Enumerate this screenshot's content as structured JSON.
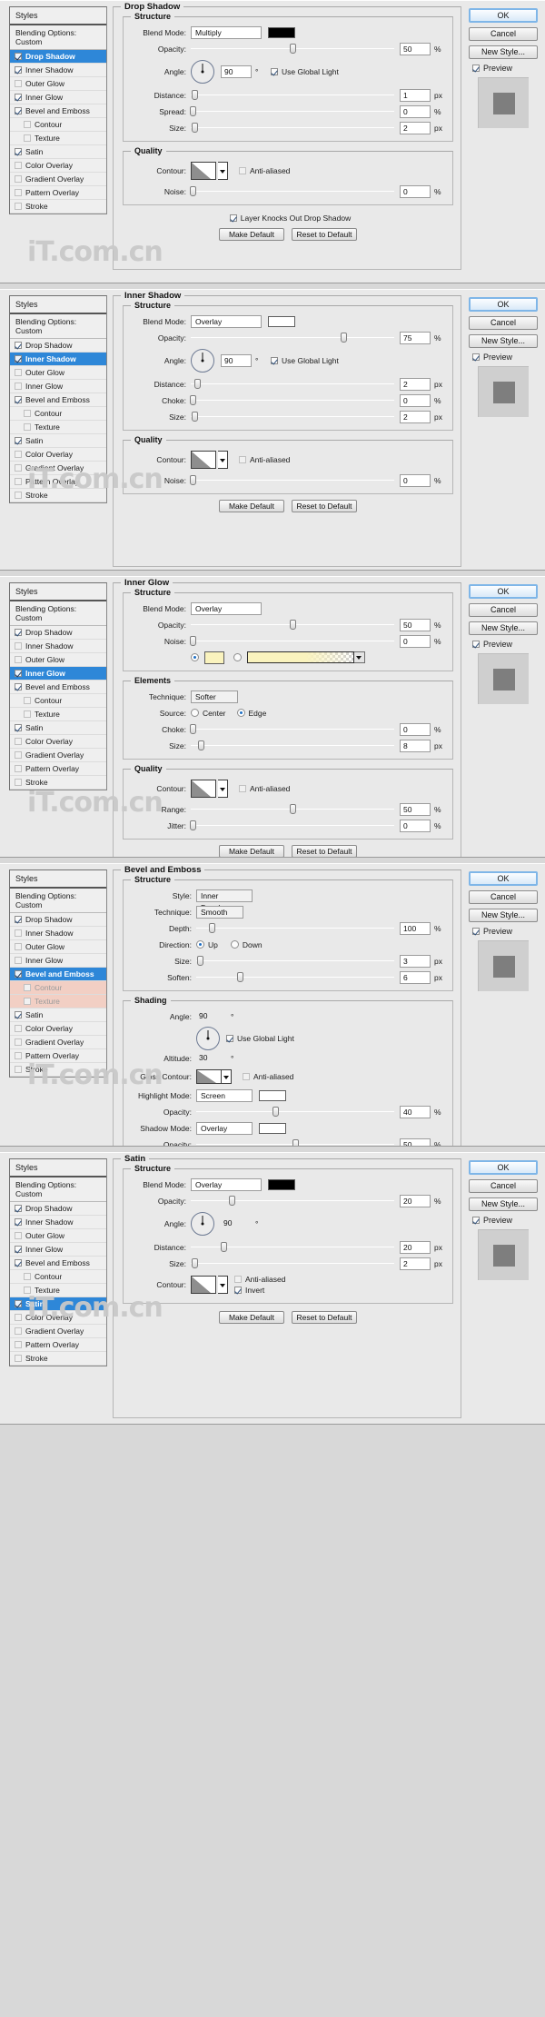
{
  "app": {
    "watermark": "iT.com.cn"
  },
  "buttons": {
    "ok": "OK",
    "cancel": "Cancel",
    "new_style": "New Style...",
    "preview": "Preview",
    "make_default": "Make Default",
    "reset_default": "Reset to Default"
  },
  "styles_panel": {
    "title": "Styles",
    "blending_options": "Blending Options: Custom",
    "items": [
      {
        "label": "Drop Shadow"
      },
      {
        "label": "Inner Shadow"
      },
      {
        "label": "Outer Glow"
      },
      {
        "label": "Inner Glow"
      },
      {
        "label": "Bevel and Emboss"
      },
      {
        "label": "Contour"
      },
      {
        "label": "Texture"
      },
      {
        "label": "Satin"
      },
      {
        "label": "Color Overlay"
      },
      {
        "label": "Gradient Overlay"
      },
      {
        "label": "Pattern Overlay"
      },
      {
        "label": "Stroke"
      }
    ]
  },
  "labels": {
    "structure": "Structure",
    "quality": "Quality",
    "elements": "Elements",
    "shading": "Shading",
    "blend_mode": "Blend Mode:",
    "opacity": "Opacity:",
    "angle": "Angle:",
    "distance": "Distance:",
    "spread": "Spread:",
    "size": "Size:",
    "contour": "Contour:",
    "noise": "Noise:",
    "choke": "Choke:",
    "range": "Range:",
    "jitter": "Jitter:",
    "technique": "Technique:",
    "source": "Source:",
    "style": "Style:",
    "depth": "Depth:",
    "direction": "Direction:",
    "soften": "Soften:",
    "altitude": "Altitude:",
    "gloss_contour": "Gloss Contour:",
    "highlight_mode": "Highlight Mode:",
    "shadow_mode": "Shadow Mode:",
    "anti_aliased": "Anti-aliased",
    "use_global_light": "Use Global Light",
    "layer_knocks_out": "Layer Knocks Out Drop Shadow",
    "invert": "Invert",
    "center": "Center",
    "edge": "Edge",
    "up": "Up",
    "down": "Down",
    "pct": "%",
    "px": "px",
    "deg": "°"
  },
  "dialogs": [
    {
      "title": "Drop Shadow",
      "selected_style": "Drop Shadow",
      "blend_mode": "Multiply",
      "color": "#000000",
      "opacity": "50",
      "angle": "90",
      "use_global_light": true,
      "distance": "1",
      "spread": "0",
      "size": "2",
      "noise": "0",
      "anti_aliased": false,
      "layer_knocks_out": true
    },
    {
      "title": "Inner Shadow",
      "selected_style": "Inner Shadow",
      "blend_mode": "Overlay",
      "color": "#ffffff",
      "opacity": "75",
      "angle": "90",
      "use_global_light": true,
      "distance": "2",
      "choke": "0",
      "size": "2",
      "noise": "0",
      "anti_aliased": false
    },
    {
      "title": "Inner Glow",
      "selected_style": "Inner Glow",
      "blend_mode": "Overlay",
      "opacity": "50",
      "noise": "0",
      "fill_type": "color",
      "color": "#faf3be",
      "technique": "Softer",
      "source": "Edge",
      "choke": "0",
      "size": "8",
      "anti_aliased": false,
      "range": "50",
      "jitter": "0"
    },
    {
      "title": "Bevel and Emboss",
      "selected_style": "Bevel and Emboss",
      "style": "Inner Bevel",
      "technique": "Smooth",
      "depth": "100",
      "direction": "Up",
      "size": "3",
      "soften": "6",
      "angle": "90",
      "use_global_light": true,
      "altitude": "30",
      "anti_aliased": false,
      "highlight_mode": "Screen",
      "highlight_color": "#ffffff",
      "highlight_opacity": "40",
      "shadow_mode": "Overlay",
      "shadow_color": "#ffffff",
      "shadow_opacity": "50"
    },
    {
      "title": "Satin",
      "selected_style": "Satin",
      "blend_mode": "Overlay",
      "color": "#000000",
      "opacity": "20",
      "angle": "90",
      "distance": "20",
      "size": "2",
      "anti_aliased": false,
      "invert": true
    }
  ]
}
